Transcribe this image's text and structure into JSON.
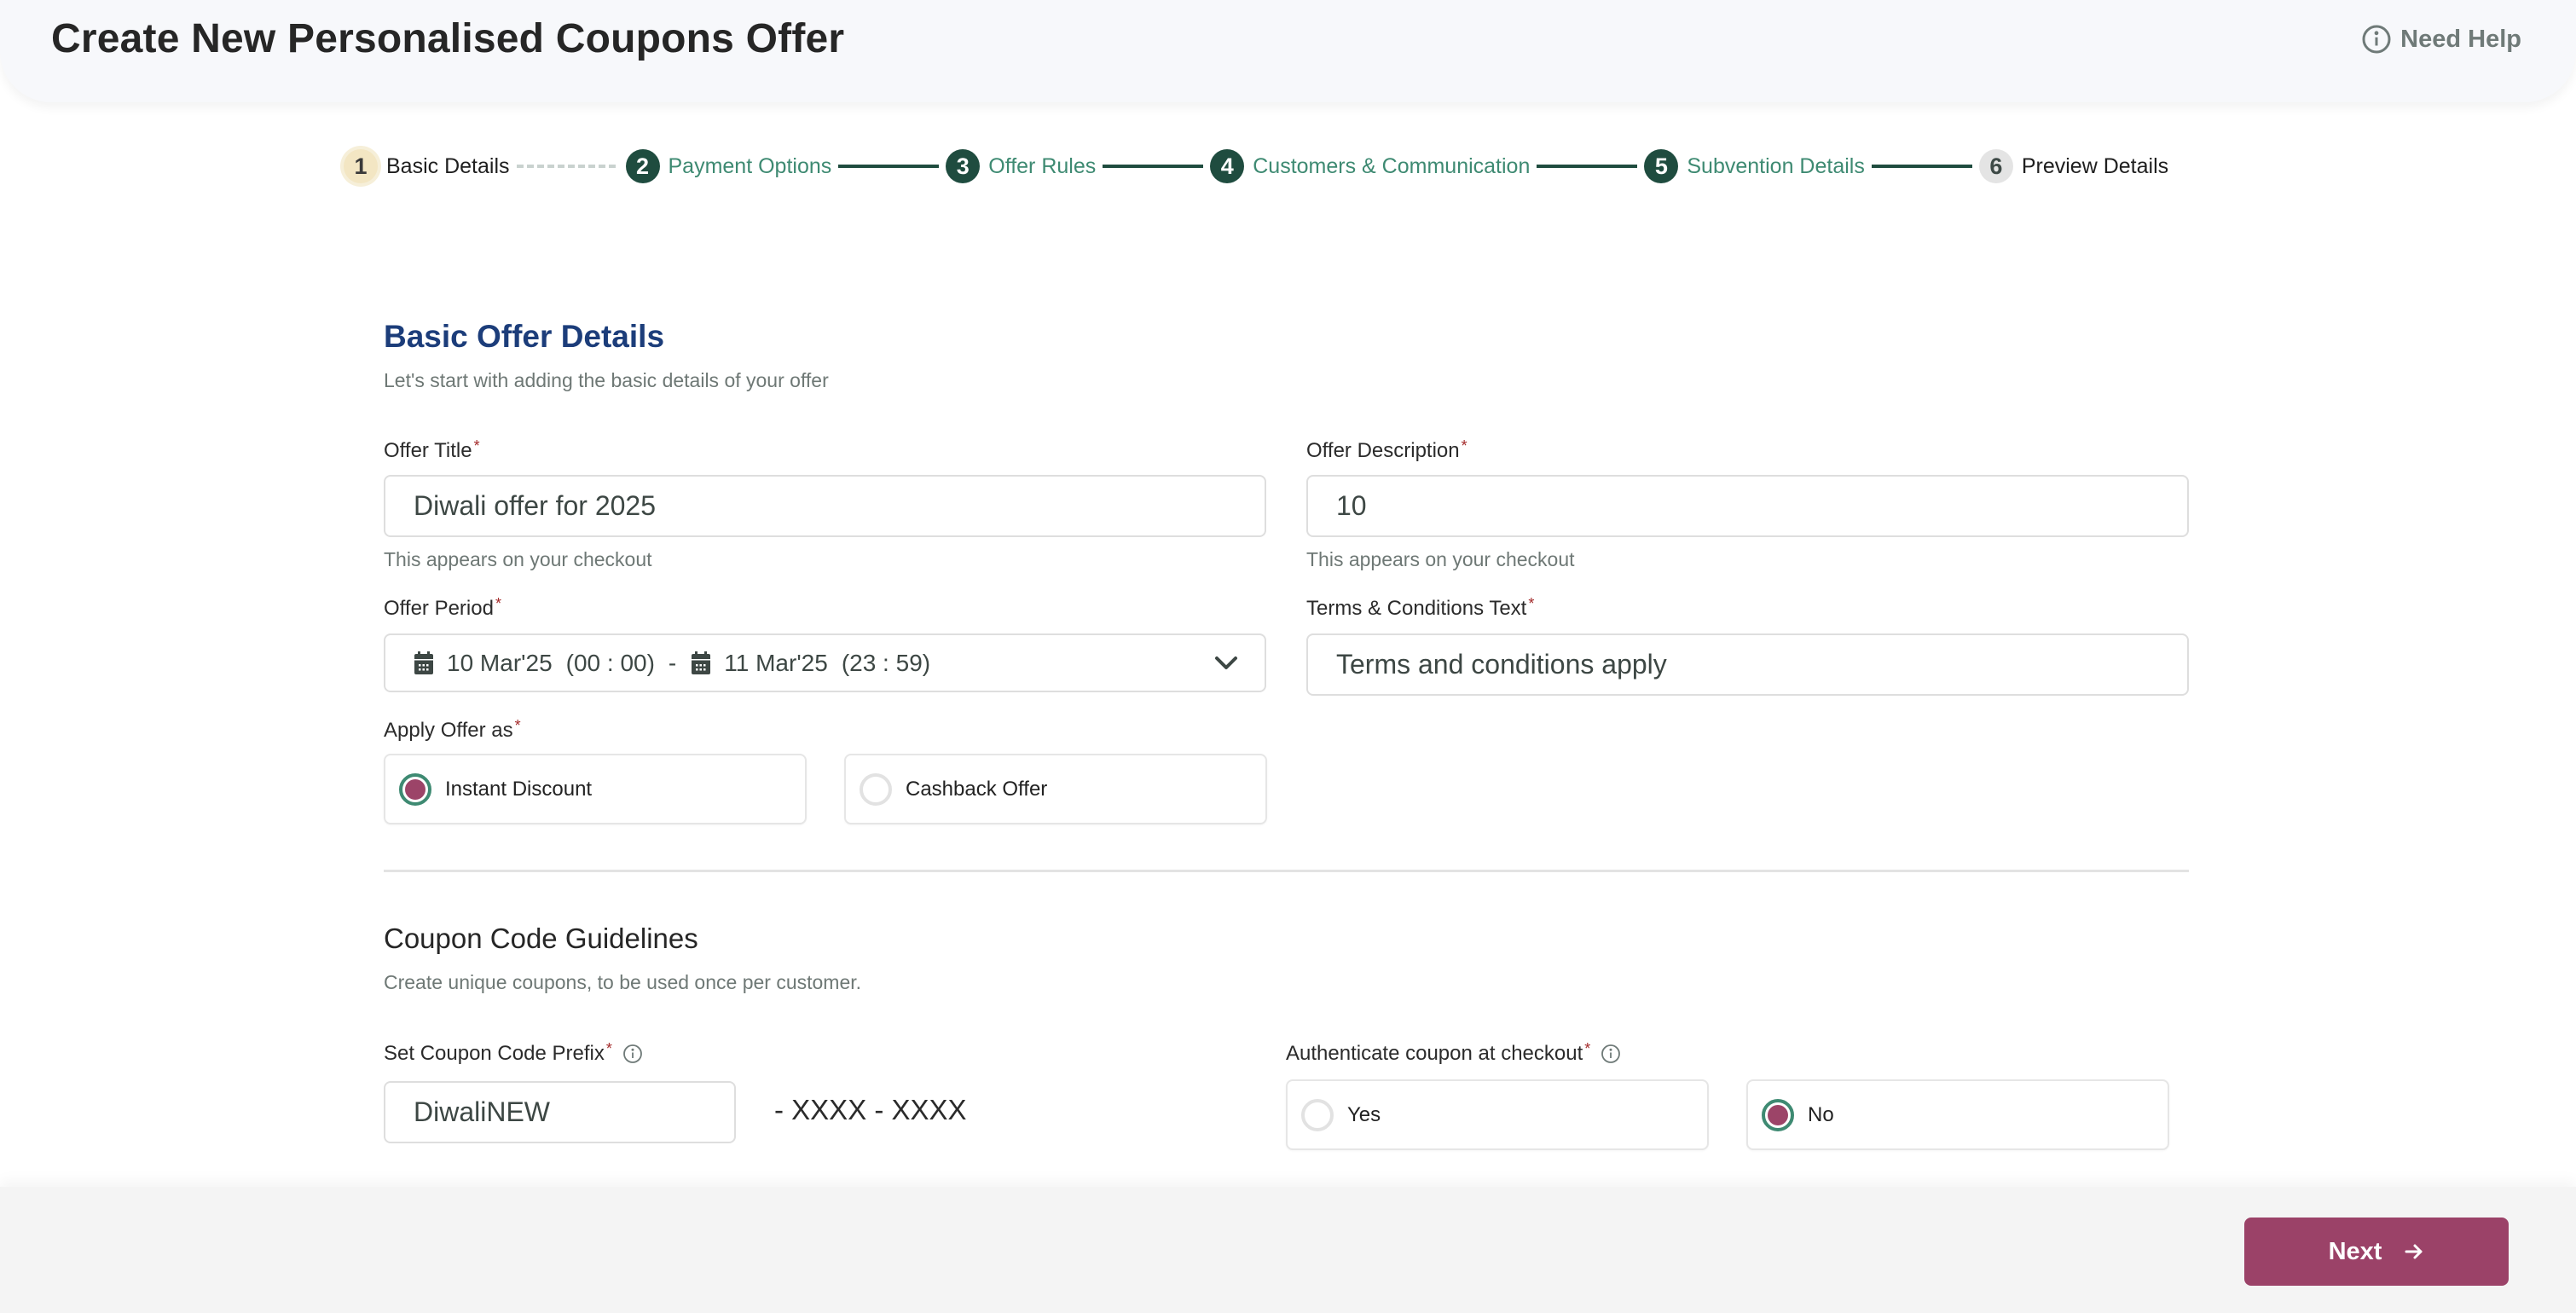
{
  "header": {
    "title": "Create New Personalised Coupons Offer",
    "help_label": "Need Help",
    "help_icon": "info-circle-icon"
  },
  "stepper": {
    "steps": [
      {
        "number": "1",
        "label": "Basic Details",
        "state": "current"
      },
      {
        "number": "2",
        "label": "Payment Options",
        "state": "done"
      },
      {
        "number": "3",
        "label": "Offer Rules",
        "state": "done"
      },
      {
        "number": "4",
        "label": "Customers & Communication",
        "state": "done"
      },
      {
        "number": "5",
        "label": "Subvention Details",
        "state": "done"
      },
      {
        "number": "6",
        "label": "Preview Details",
        "state": "pending"
      }
    ]
  },
  "basic_details": {
    "title": "Basic Offer Details",
    "subtitle": "Let's start with adding the basic details of your offer",
    "offer_title": {
      "label": "Offer Title",
      "required": "*",
      "value": "Diwali offer for 2025",
      "hint": "This appears on your checkout"
    },
    "offer_description": {
      "label": "Offer Description",
      "required": "*",
      "value": "10",
      "hint": "This appears on your checkout"
    },
    "offer_period": {
      "label": "Offer Period",
      "required": "*",
      "start_date": "10 Mar'25",
      "start_time": "(00 : 00)",
      "separator": "-",
      "end_date": "11 Mar'25",
      "end_time": "(23 : 59)",
      "icon": "calendar-icon"
    },
    "terms": {
      "label": "Terms & Conditions Text",
      "required": "*",
      "value": "Terms and conditions apply"
    },
    "apply_offer_as": {
      "label": "Apply Offer as",
      "required": "*",
      "options": [
        {
          "label": "Instant Discount",
          "checked": true
        },
        {
          "label": "Cashback Offer",
          "checked": false
        }
      ]
    }
  },
  "coupon_guidelines": {
    "title": "Coupon Code Guidelines",
    "subtitle": "Create unique coupons, to be used once per customer.",
    "prefix": {
      "label": "Set Coupon Code Prefix",
      "required": "*",
      "value": "DiwaliNEW",
      "suffix": "- XXXX - XXXX"
    },
    "authenticate": {
      "label": "Authenticate coupon at checkout",
      "required": "*",
      "options": [
        {
          "label": "Yes",
          "checked": false
        },
        {
          "label": "No",
          "checked": true
        }
      ]
    }
  },
  "footer": {
    "next_label": "Next"
  },
  "colors": {
    "primary_button": "#9b4268",
    "step_done": "#1f4c3f",
    "step_label_done": "#3e8a72",
    "step_current_bg": "#f3e6c3",
    "section_title": "#1c3d7a",
    "radio_ring": "#3e8a72",
    "radio_dot": "#9c4468",
    "required_asterisk": "#a32a2a"
  }
}
